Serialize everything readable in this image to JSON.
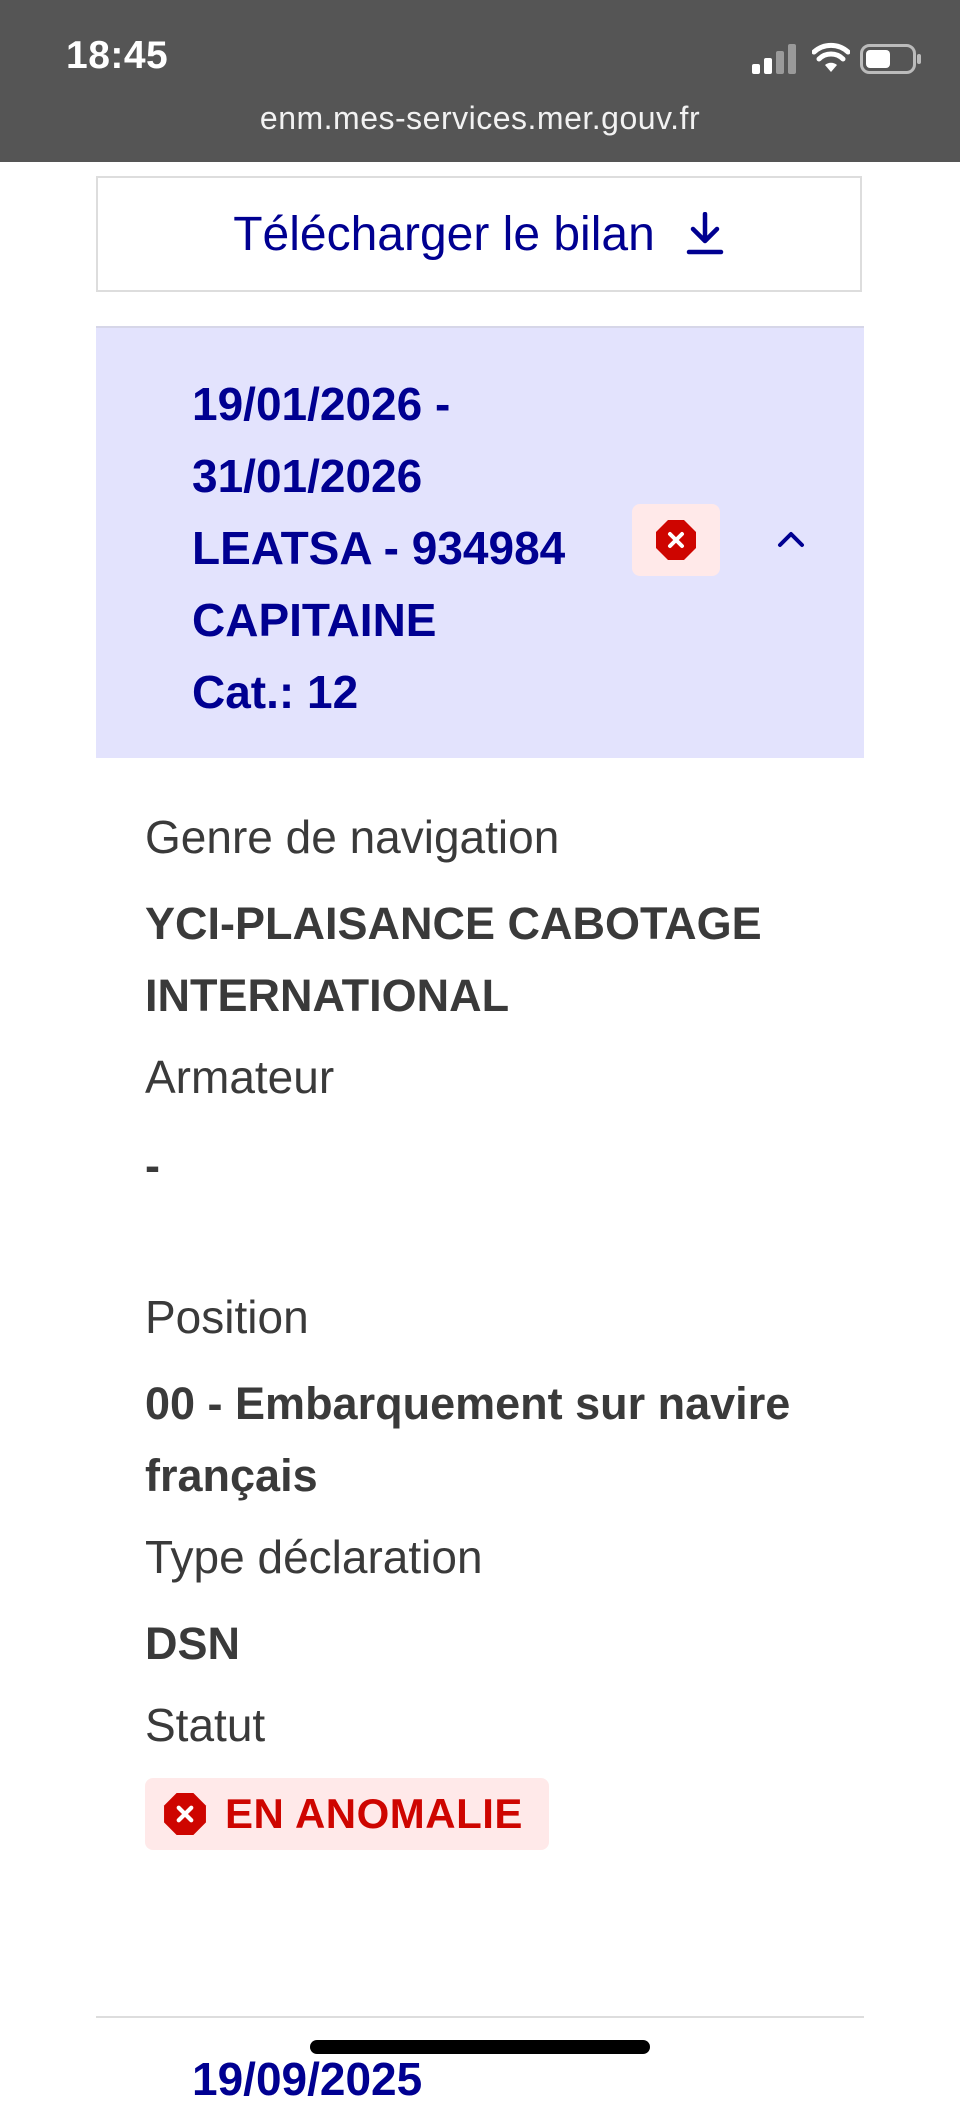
{
  "status_bar": {
    "time": "18:45",
    "url": "enm.mes-services.mer.gouv.fr"
  },
  "download": {
    "label": "Télécharger le bilan",
    "icon": "download-icon"
  },
  "accordion": {
    "lines": [
      "19/01/2026 -",
      "31/01/2026",
      "LEATSA - 934984",
      "CAPITAINE",
      "Cat.: 12"
    ],
    "status_icon": "error-octagon-icon",
    "toggle_icon": "chevron-up-icon",
    "expanded": true
  },
  "details": {
    "genre_label": "Genre de navigation",
    "genre_value_1": "YCI-PLAISANCE CABOTAGE",
    "genre_value_2": "INTERNATIONAL",
    "armateur_label": "Armateur",
    "armateur_value": "-",
    "position_label": "Position",
    "position_value_1": "00 - Embarquement sur navire",
    "position_value_2": "français",
    "type_label": "Type déclaration",
    "type_value": "DSN",
    "statut_label": "Statut",
    "statut_value": "EN ANOMALIE"
  },
  "next_item": {
    "partial_text": "19/09/2025"
  },
  "colors": {
    "status_bar_bg": "#555555",
    "accent_blue": "#000091",
    "accordion_bg": "#e3e3fd",
    "error_red": "#ce0500",
    "error_bg": "#ffe9e9",
    "text_dark": "#3a3a3a"
  }
}
